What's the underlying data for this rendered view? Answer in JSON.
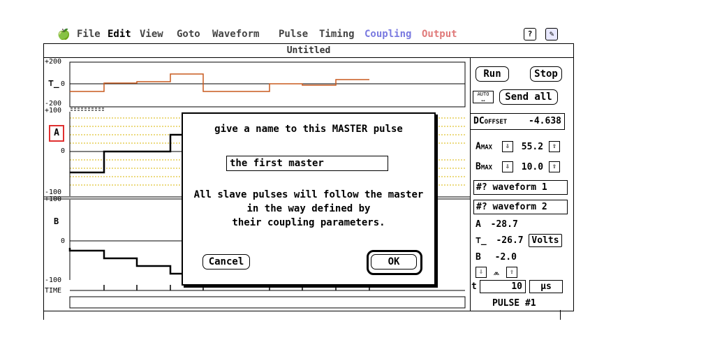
{
  "menubar": {
    "apple_icon": "apple-logo",
    "items": [
      "File",
      "Edit",
      "View",
      "Goto",
      "Waveform",
      "Pulse",
      "Timing",
      "Coupling",
      "Output"
    ],
    "help_icon": "question-icon",
    "app_icon": "app-icon"
  },
  "window": {
    "title": "Untitled"
  },
  "plot_a": {
    "y_top": "+200",
    "y_mid": "0",
    "y_bottom": "-200"
  },
  "plot_main": {
    "y_top": "+100",
    "y_mid": "0",
    "y_bottom": "-100",
    "channel": "A"
  },
  "plot_b": {
    "y_top": "+100",
    "y_mid": "0",
    "y_bottom": "-100",
    "channel": "B",
    "time_label": "TIME"
  },
  "right_panel": {
    "run": "Run",
    "stop": "Stop",
    "auto": "AUTO",
    "send_all": "Send all",
    "dc_offset_label": "DC",
    "dc_offset_sub": "OFFSET",
    "dc_offset_value": "-4.638",
    "a_max_label": "A",
    "a_max_sub": "MAX",
    "a_max_value": "55.2",
    "b_max_label": "B",
    "b_max_sub": "MAX",
    "b_max_value": "10.0",
    "waveform1": "#? waveform 1",
    "waveform2": "#? waveform 2",
    "a_label": "A",
    "a_value": "-28.7",
    "offset_value": "-26.7",
    "volts": "Volts",
    "b_label": "B",
    "b_value": "-2.0",
    "t_label": "t",
    "t_value": "10",
    "t_unit": "µs",
    "pulse_label": "PULSE #1"
  },
  "dialog": {
    "title": "give a name to this MASTER pulse",
    "input_value": "the first master",
    "message_line1": "All slave pulses will follow the master",
    "message_line2": "in the way defined by",
    "message_line3": "their coupling parameters.",
    "cancel": "Cancel",
    "ok": "OK"
  },
  "colors": {
    "coupling": "#7a7ae0",
    "output": "#e07a7a",
    "trace_orange": "#c85a1e",
    "dotted_yellow": "#d8b400"
  },
  "chart_data": [
    {
      "type": "line",
      "ylim": [
        -200,
        200
      ],
      "series": [
        {
          "values": [
            -40,
            -40,
            0,
            0,
            10,
            10,
            50,
            50,
            -40,
            -40,
            0,
            0,
            -10,
            -10,
            20,
            20
          ]
        }
      ]
    },
    {
      "type": "line",
      "ylim": [
        -100,
        100
      ],
      "series": [
        {
          "values": [
            -30,
            0,
            0,
            45,
            45
          ]
        }
      ]
    },
    {
      "type": "line",
      "ylim": [
        -100,
        100
      ],
      "series": [
        {
          "values": [
            -10,
            -20,
            -30,
            -40
          ]
        }
      ]
    }
  ]
}
